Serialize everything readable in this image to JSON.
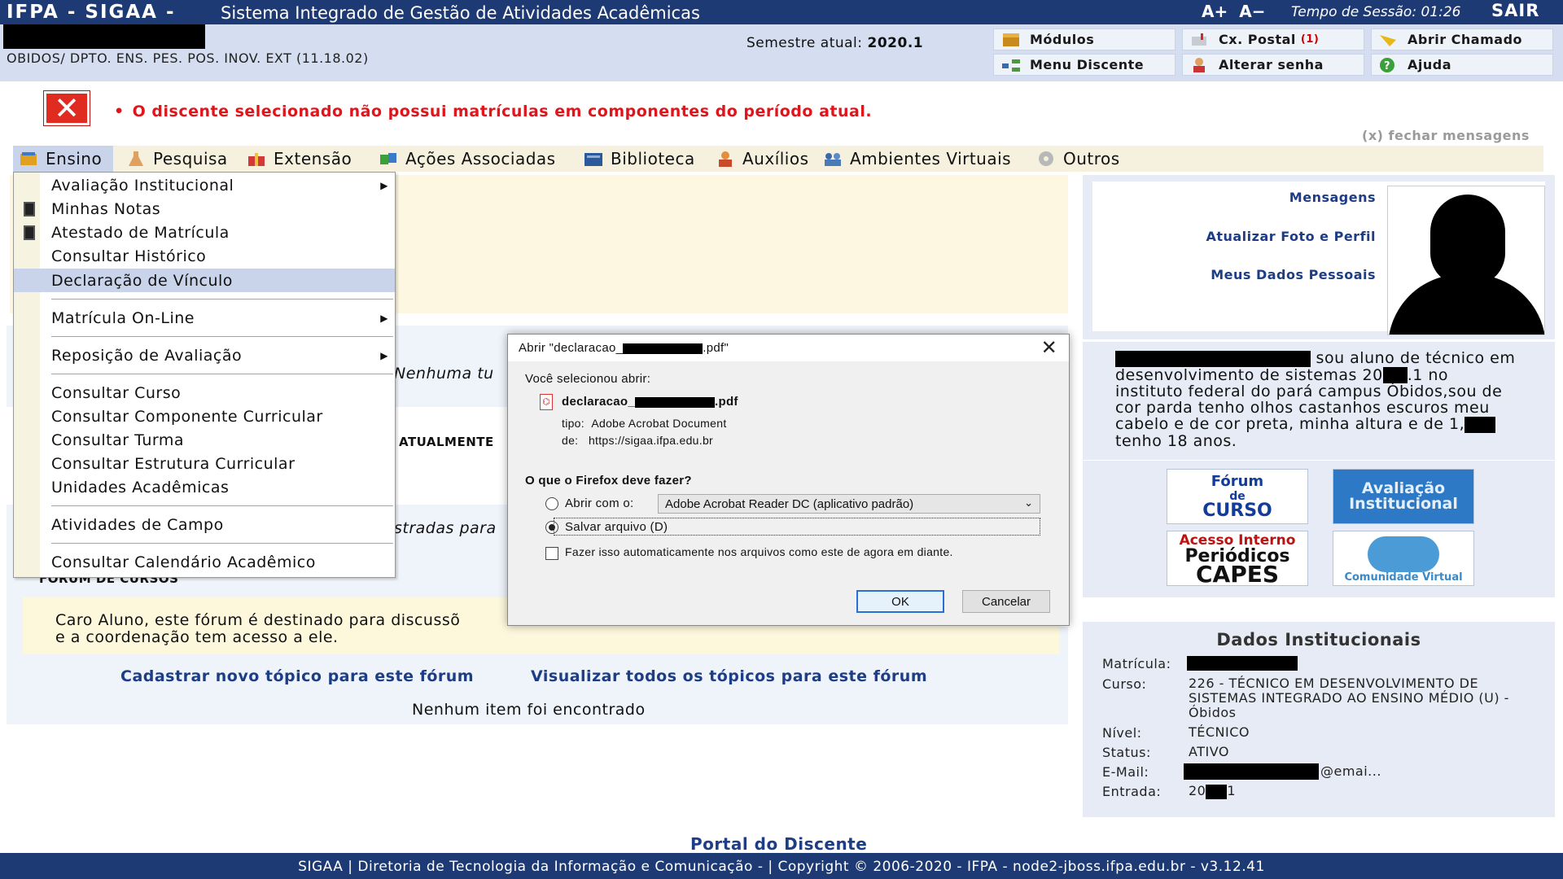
{
  "header": {
    "brand": "IFPA - SIGAA -",
    "system_title": "Sistema Integrado de Gestão de Atividades Acadêmicas",
    "font_increase": "A+",
    "font_decrease": "A−",
    "session_label": "Tempo de Sessão: 01:26",
    "logout": "SAIR"
  },
  "info": {
    "unit": "OBIDOS/ DPTO. ENS. PES. POS. INOV. EXT (11.18.02)",
    "semester_label": "Semestre atual:",
    "semester_value": "2020.1",
    "quick_buttons": [
      {
        "label": "Módulos"
      },
      {
        "label": "Cx. Postal",
        "badge": "(1)"
      },
      {
        "label": "Abrir Chamado"
      },
      {
        "label": "Menu Discente"
      },
      {
        "label": "Alterar senha"
      },
      {
        "label": "Ajuda"
      }
    ]
  },
  "message": {
    "error_text": "O discente selecionado não possui matrículas em componentes do período atual.",
    "close_text": "(x) fechar mensagens"
  },
  "menu": [
    {
      "label": "Ensino",
      "icon": "book-icon"
    },
    {
      "label": "Pesquisa",
      "icon": "flask-icon"
    },
    {
      "label": "Extensão",
      "icon": "gift-icon"
    },
    {
      "label": "Ações Associadas",
      "icon": "puzzle-icon"
    },
    {
      "label": "Biblioteca",
      "icon": "books-icon"
    },
    {
      "label": "Auxílios",
      "icon": "person-icon"
    },
    {
      "label": "Ambientes Virtuais",
      "icon": "people-icon"
    },
    {
      "label": "Outros",
      "icon": "gear-icon"
    }
  ],
  "dropdown": [
    {
      "label": "Avaliação Institucional",
      "submenu": "▶"
    },
    {
      "label": "Minhas Notas"
    },
    {
      "label": "Atestado de Matrícula"
    },
    {
      "label": "Consultar Histórico"
    },
    {
      "label": "Declaração de Vínculo"
    },
    {
      "label": "Matrícula On-Line",
      "submenu": "▶"
    },
    {
      "label": "Reposição de Avaliação",
      "submenu": "▶"
    },
    {
      "label": "Consultar Curso"
    },
    {
      "label": "Consultar Componente Curricular"
    },
    {
      "label": "Consultar Turma"
    },
    {
      "label": "Consultar Estrutura Curricular"
    },
    {
      "label": "Unidades Acadêmicas"
    },
    {
      "label": "Atividades de Campo"
    },
    {
      "label": "Consultar Calendário Acadêmico"
    }
  ],
  "main": {
    "nenhuma_partial": "Nenhuma tu",
    "atualmente_partial": "ATUALMENTE",
    "stradas_partial": "stradas para",
    "forum_heading": "FÓRUM DE CURSOS",
    "forum_note_line1": "Caro Aluno, este fórum é destinado para discussõ",
    "forum_note_line2": "e a coordenação tem acesso a ele.",
    "link_new_topic": "Cadastrar novo tópico para este fórum",
    "link_all_topics": "Visualizar todos os tópicos para este fórum",
    "no_items": "Nenhum item foi encontrado"
  },
  "dialog": {
    "title": "Abrir \"declaracao_",
    "title_suffix": ".pdf\"",
    "close": "✕",
    "selected_label": "Você selecionou abrir:",
    "file_name_prefix": "declaracao_",
    "file_name_suffix": ".pdf",
    "type_label": "tipo:",
    "type_value": "Adobe Acrobat Document",
    "from_label": "de:",
    "from_value": "https://sigaa.ifpa.edu.br",
    "question": "O que o Firefox deve fazer?",
    "open_with_label": "Abrir com o:",
    "open_with_value": "Adobe Acrobat Reader DC (aplicativo padrão)",
    "save_label": "Salvar arquivo (D)",
    "auto_label": "Fazer isso automaticamente nos arquivos como este de agora em diante.",
    "ok": "OK",
    "cancel": "Cancelar"
  },
  "sidebar": {
    "link_messages": "Mensagens",
    "link_update_photo": "Atualizar Foto e Perfil",
    "link_personal_data": "Meus Dados Pessoais",
    "bio_1": "sou aluno de técnico em",
    "bio_2a": "desenvolvimento de sistemas 20",
    "bio_2b": ".1 no",
    "bio_3": "instituto federal do pará campus Óbidos,sou de",
    "bio_4": "cor parda tenho olhos castanhos escuros meu",
    "bio_5": "cabelo e de cor preta, minha altura e de 1,",
    "bio_6": "tenho 18 anos.",
    "tiles": {
      "forum_l1": "Fórum",
      "forum_l2": "de",
      "forum_l3": "CURSO",
      "aval_l1": "Avaliação",
      "aval_l2": "Institucional",
      "capes_l1": "Acesso Interno",
      "capes_l2": "Periódicos",
      "capes_l3": "CAPES",
      "comun": "Comunidade Virtual"
    },
    "inst_heading": "Dados Institucionais",
    "matricula_label": "Matrícula:",
    "curso_label": "Curso:",
    "curso_value": "226 - TÉCNICO EM DESENVOLVIMENTO DE SISTEMAS INTEGRADO AO ENSINO MÉDIO (U) - Óbidos",
    "nivel_label": "Nível:",
    "nivel_value": "TÉCNICO",
    "status_label": "Status:",
    "status_value": "ATIVO",
    "email_label": "E-Mail:",
    "email_suffix": "@emai...",
    "entrada_label": "Entrada:",
    "entrada_a": "20",
    "entrada_b": "1"
  },
  "footer": {
    "portal": "Portal do Discente",
    "text": "SIGAA | Diretoria de Tecnologia da Informação e Comunicação - | Copyright © 2006-2020 - IFPA - node2-jboss.ifpa.edu.br - v3.12.41"
  },
  "colors": {
    "header_bg": "#1e3a74",
    "info_bg": "#d4def0",
    "error_red": "#e0151b",
    "link_blue": "#1d3d86",
    "menu_bg": "#f5f1de",
    "highlight": "#c9d4ea"
  }
}
